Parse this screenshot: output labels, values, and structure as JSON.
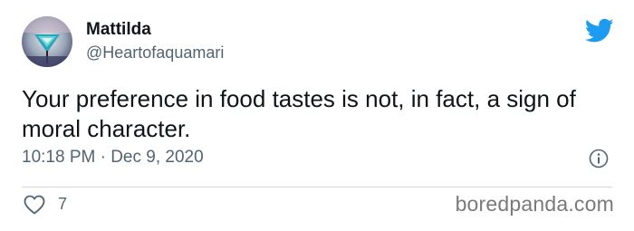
{
  "author": {
    "name": "Mattilda",
    "handle": "@Heartofaquamari"
  },
  "tweet": {
    "text": "Your preference in food tastes is not, in fact, a sign of moral character.",
    "timestamp": "10:18 PM · Dec 9, 2020"
  },
  "actions": {
    "like_count": "7"
  },
  "watermark": "boredpanda.com",
  "icons": {
    "brand": "twitter-bird-icon",
    "info": "info-icon",
    "like": "heart-icon"
  },
  "colors": {
    "twitter_blue": "#1d9bf0",
    "text_primary": "#0f1419",
    "text_secondary": "#536471",
    "divider": "#cfd9de",
    "watermark": "#7a7a7a"
  }
}
